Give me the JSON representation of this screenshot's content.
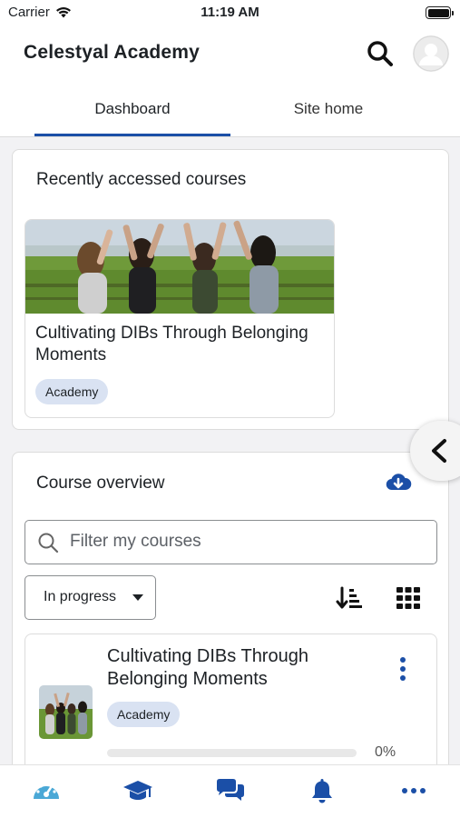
{
  "status_bar": {
    "carrier": "Carrier",
    "time": "11:19 AM"
  },
  "header": {
    "title": "Celestyal Academy"
  },
  "tabs": [
    {
      "label": "Dashboard",
      "active": true
    },
    {
      "label": "Site home",
      "active": false
    }
  ],
  "recent": {
    "heading": "Recently accessed courses",
    "course": {
      "name": "Cultivating DIBs Through Belonging Moments",
      "category": "Academy"
    }
  },
  "overview": {
    "heading": "Course overview",
    "filter_placeholder": "Filter my courses",
    "status_filter": "In progress",
    "course": {
      "name": "Cultivating DIBs Through Belonging Moments",
      "category": "Academy",
      "progress": 0,
      "progress_label": "0%"
    }
  },
  "colors": {
    "brand_blue": "#1b4fa7",
    "progress": "#5fc1e6",
    "badge_bg": "#d9e2f2",
    "nav_icon": "#1b4fa7",
    "dashboard_icon": "#4aa8d6"
  },
  "bottom_nav": [
    {
      "icon": "dashboard-gauge-icon"
    },
    {
      "icon": "graduation-cap-icon"
    },
    {
      "icon": "chat-bubbles-icon"
    },
    {
      "icon": "bell-icon"
    },
    {
      "icon": "more-dots-icon"
    }
  ]
}
